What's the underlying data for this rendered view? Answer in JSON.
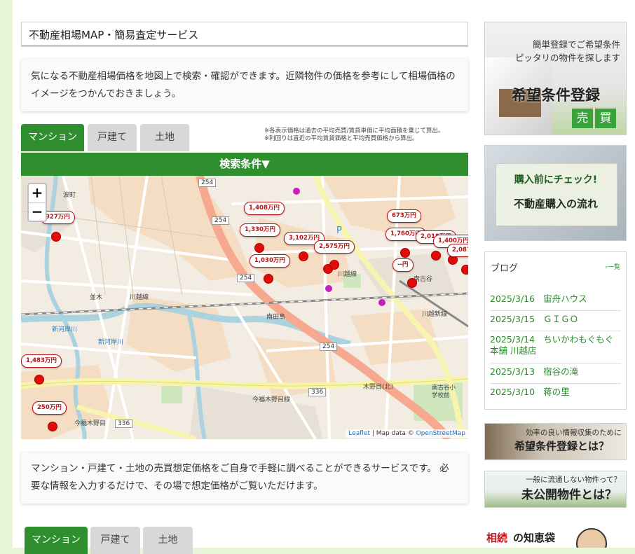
{
  "page_title": "不動産相場MAP・簡易査定サービス",
  "intro_text": "気になる不動産相場価格を地図上で検索・確認ができます。近隣物件の価格を参考にして相場価格のイメージをつかんでおきましょう。",
  "tabs": [
    {
      "label": "マンション",
      "active": true
    },
    {
      "label": "戸建て",
      "active": false
    },
    {
      "label": "土地",
      "active": false
    }
  ],
  "notes": [
    "※各表示価格は過去の平均売買/賃貸単価に平均面積を乗じて算出。",
    "※利回りは直近の平均賃貸価格と平均売買価格から算出。"
  ],
  "search_label": "検索条件▼",
  "map": {
    "zoom_in": "+",
    "zoom_out": "−",
    "attribution_leaflet": "Leaflet",
    "attribution_sep": " | Map data © ",
    "attribution_osm": "OpenStreetMap",
    "labels": {
      "road_254_a": "254",
      "road_254_b": "254",
      "road_254_c": "254",
      "road_254_d": "254",
      "road_336_a": "336",
      "road_336_b": "336",
      "kawagoe_line_a": "川越線",
      "kawagoe_line_b": "川越線",
      "kawagoe_new": "川越新線",
      "minamitaka": "南田島",
      "kibou": "木野目(北)",
      "minamifuruya": "南古谷",
      "minamifuruya_school": "南古谷小学校前",
      "imafuku_a": "今福木野目線",
      "imafuku_b": "今福木野目",
      "shingashi_a": "新河岸川",
      "shingashi_b": "新河岸川",
      "namiki": "並木",
      "nanba": "波町"
    },
    "markers": [
      {
        "price": "927万円"
      },
      {
        "price": "1,408万円"
      },
      {
        "price": "1,330万円"
      },
      {
        "price": "3,102万円"
      },
      {
        "price": "2,575万円"
      },
      {
        "price": "1,030万円"
      },
      {
        "price": "673万円"
      },
      {
        "price": "1,760万円"
      },
      {
        "price": "2,018万円"
      },
      {
        "price": "1,400万円"
      },
      {
        "price": "2,087"
      },
      {
        "price": "--円"
      },
      {
        "price": "1,483万円"
      },
      {
        "price": "250万円"
      }
    ]
  },
  "description_text": "マンション・戸建て・土地の売買想定価格をご自身で手軽に調べることができるサービスです。 必要な情報を入力するだけで、その場で想定価格がご覧いただけます。",
  "sidebar": {
    "banner1": {
      "line1": "簡単登録でご希望条件",
      "line2": "ピッタリの物件を探します",
      "title": "希望条件登録",
      "badge1": "売",
      "badge2": "買"
    },
    "banner2": {
      "line1": "購入前にチェック!",
      "line2": "不動産購入の流れ"
    },
    "blog": {
      "heading": "ブログ",
      "more": "一覧",
      "items": [
        {
          "date": "2025/3/16",
          "title": "宙舟ハウス"
        },
        {
          "date": "2025/3/15",
          "title": "ＧＩＧＯ"
        },
        {
          "date": "2025/3/14",
          "title": "ちいかわもぐもぐ本舗 川越店"
        },
        {
          "date": "2025/3/13",
          "title": "宿谷の滝"
        },
        {
          "date": "2025/3/10",
          "title": "蒋の里"
        }
      ]
    },
    "banner3": {
      "line1": "効率の良い情報収集のために",
      "line2": "希望条件登録とは？"
    },
    "banner4": {
      "line1": "一般に流通しない物件って？",
      "line2": "未公開物件とは？"
    },
    "chiebukuro": {
      "accent": "相続",
      "rest": "の知恵袋"
    }
  },
  "tabs_bottom": [
    {
      "label": "マンション",
      "active": true
    },
    {
      "label": "戸建て",
      "active": false
    },
    {
      "label": "土地",
      "active": false
    }
  ],
  "colors": {
    "accent_green": "#2f8f2f",
    "marker_red": "#e00b0b",
    "page_bg": "#e8f5d9"
  }
}
